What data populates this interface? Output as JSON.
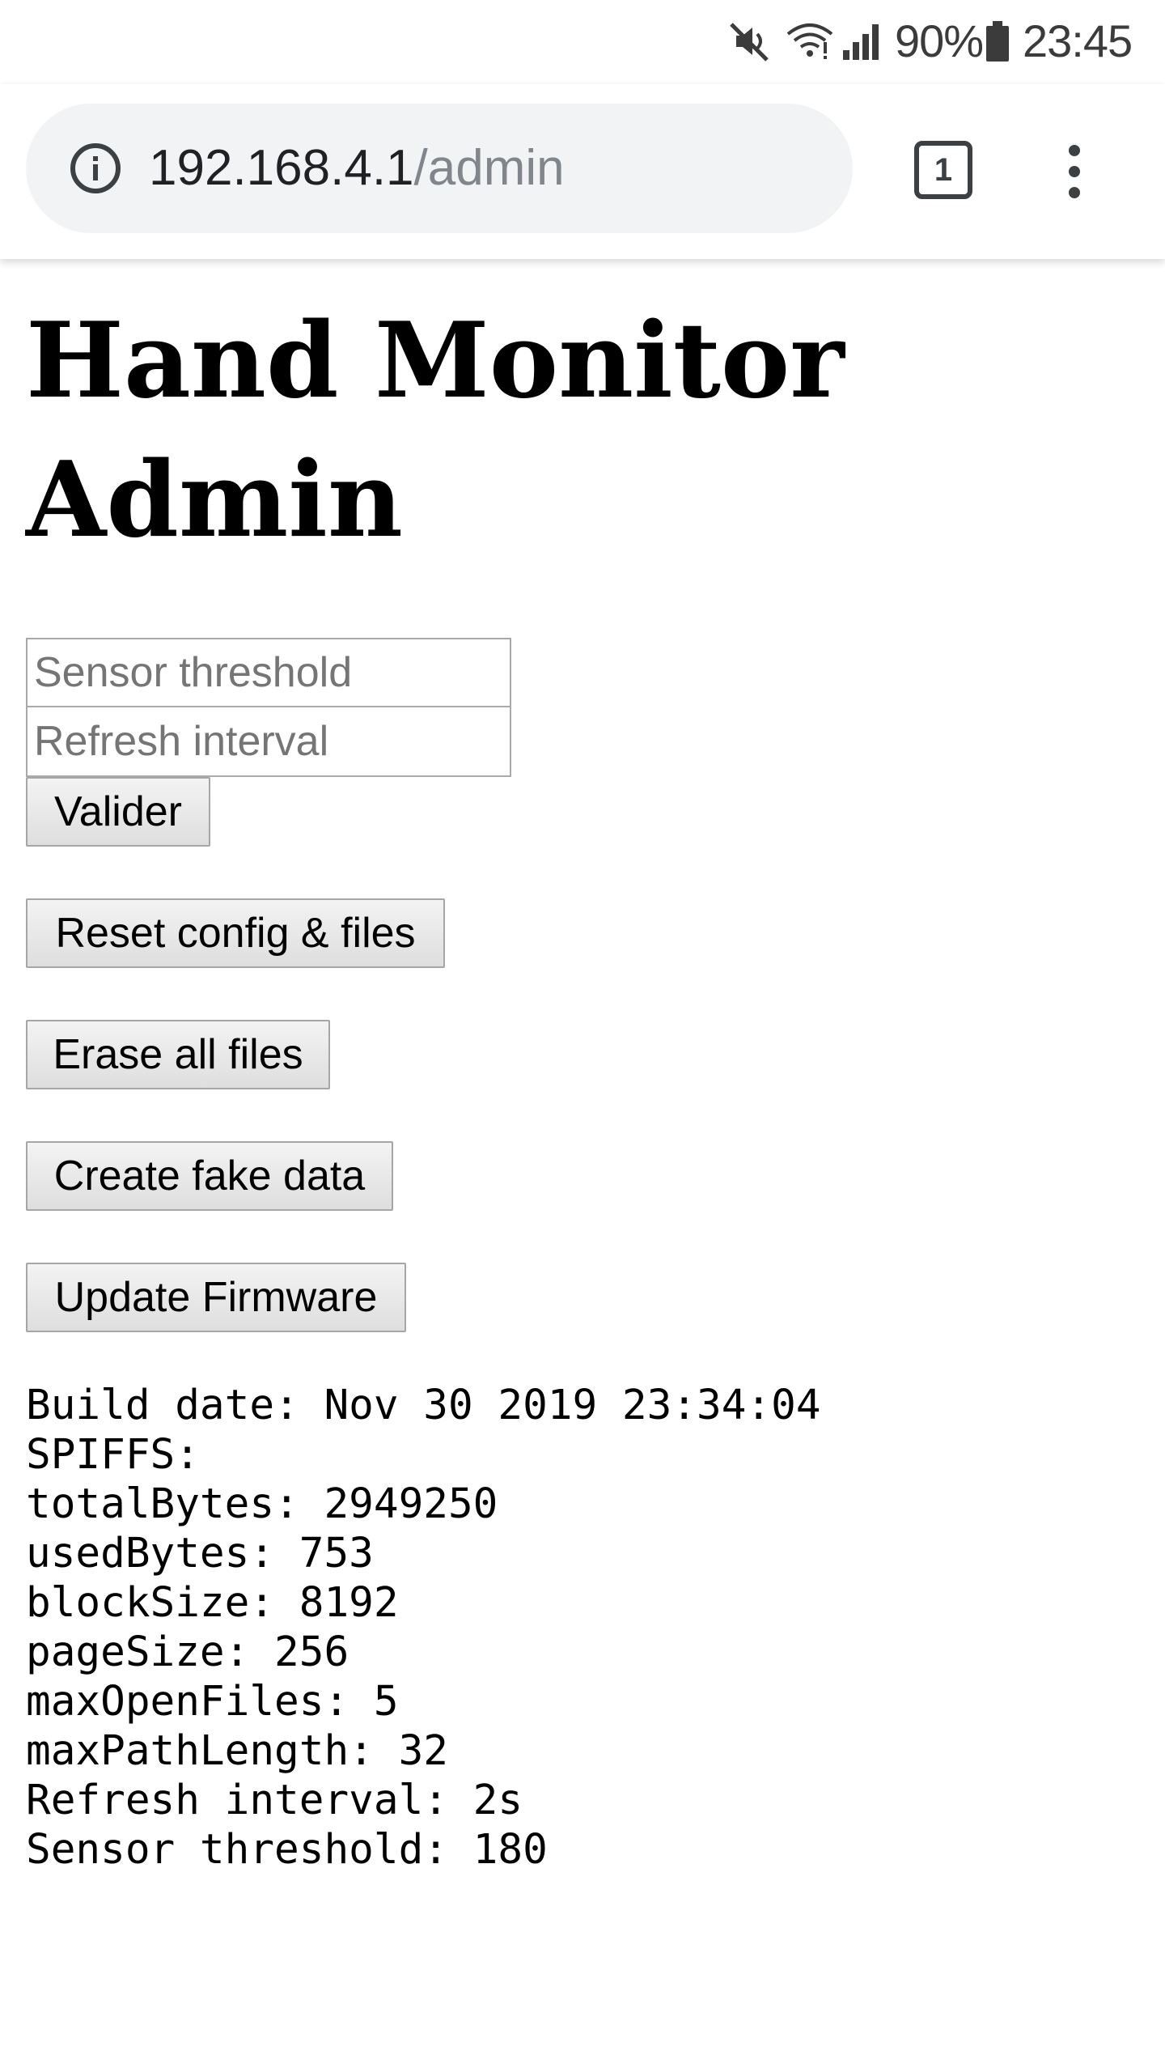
{
  "status_bar": {
    "battery_percent": "90%",
    "time": "23:45",
    "icons": [
      "mute-icon",
      "wifi-icon",
      "signal-icon",
      "battery-icon"
    ]
  },
  "browser": {
    "url_host": "192.168.4.1",
    "url_path": "/admin",
    "tab_count": "1",
    "icons": [
      "info-icon",
      "tab-switcher-icon",
      "more-vert-icon"
    ]
  },
  "page": {
    "title": "Hand Monitor Admin",
    "form": {
      "threshold_placeholder": "Sensor threshold",
      "interval_placeholder": "Refresh interval",
      "submit_label": "Valider"
    },
    "buttons": {
      "reset": "Reset config & files",
      "erase": "Erase all files",
      "fake_data": "Create fake data",
      "firmware": "Update Firmware"
    },
    "info_lines": [
      "Build date: Nov 30 2019 23:34:04",
      "SPIFFS:",
      "totalBytes: 2949250",
      "usedBytes: 753",
      "blockSize: 8192",
      "pageSize: 256",
      "maxOpenFiles: 5",
      "maxPathLength: 32",
      "Refresh interval: 2s",
      "Sensor threshold: 180"
    ]
  },
  "colors": {
    "status_text": "#3b3b3b",
    "omnibox_bg": "#f1f3f4",
    "url_host": "#202124",
    "url_path": "#80868b",
    "button_border": "#a6a6a6"
  }
}
